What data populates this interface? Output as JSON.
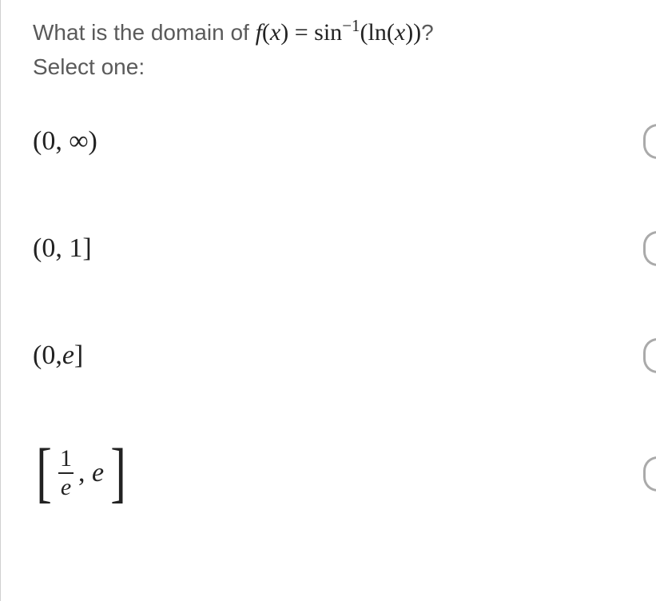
{
  "question": {
    "prefix": "What is the domain of ",
    "func_name": "f",
    "var": "x",
    "rhs_part1": "sin",
    "rhs_exp": "−1",
    "rhs_part2": "(ln(",
    "rhs_part3": "))",
    "qmark": "?"
  },
  "select_label": "Select one:",
  "options": {
    "a": "(0, ∞)",
    "b": "(0, 1]",
    "c": "(0, e]",
    "d": {
      "lbracket": "[",
      "num": "1",
      "den": "e",
      "after": ", e",
      "rbracket": "]"
    }
  }
}
